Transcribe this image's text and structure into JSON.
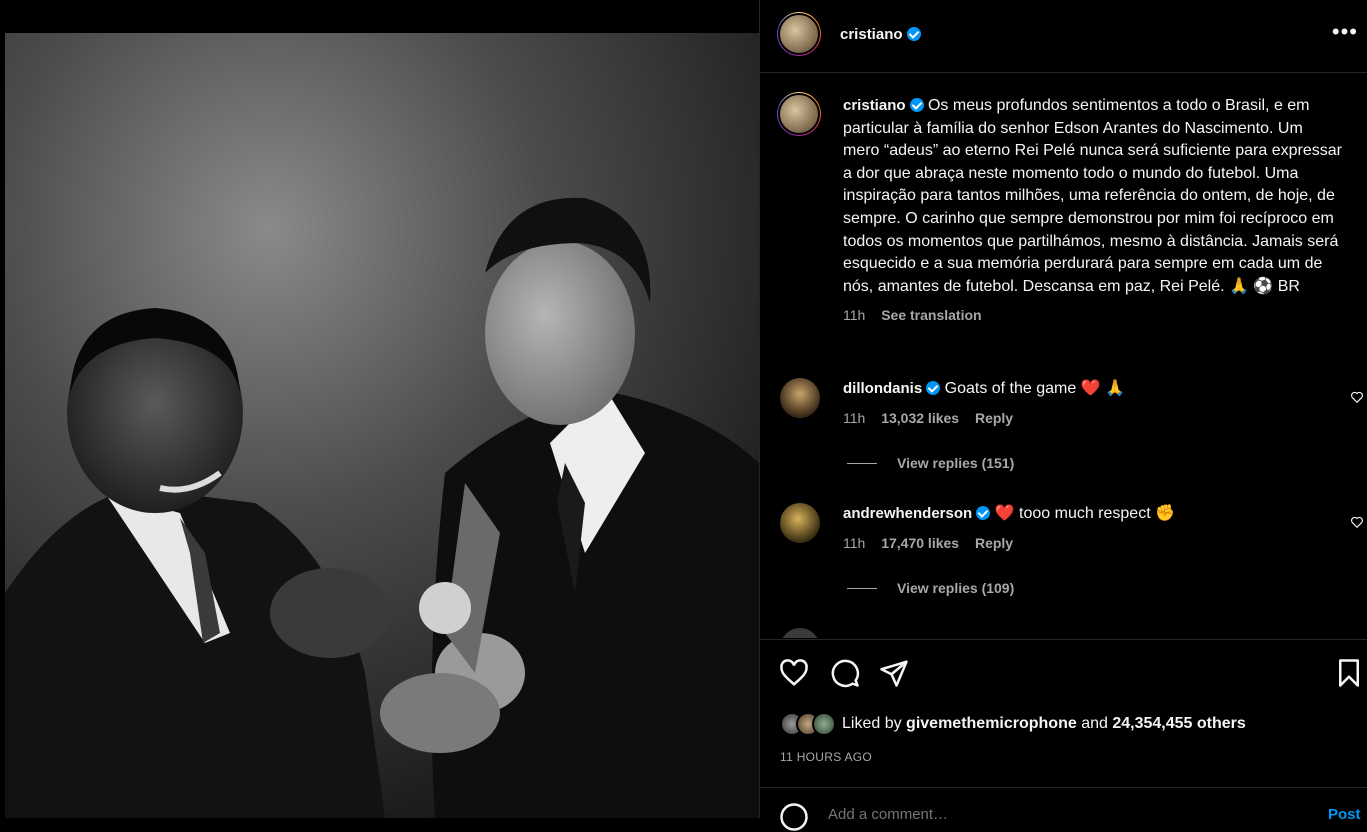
{
  "post": {
    "username": "cristiano",
    "more_label": "•••"
  },
  "caption": {
    "username": "cristiano",
    "text": "Os meus profundos sentimentos a todo o Brasil, e em particular à família do senhor Edson Arantes do Nascimento. Um mero “adeus” ao eterno Rei Pelé nunca será suficiente para expressar a dor que abraça neste momento todo o mundo do futebol. Uma inspiração para tantos milhões, uma referência do ontem, de hoje, de sempre. O carinho que sempre demonstrou por mim foi recíproco em todos os momentos que partilhámos, mesmo à distância. Jamais será esquecido e a sua memória perdurará para sempre em cada um de nós, amantes de futebol. Descansa em paz, Rei Pelé. 🙏 ⚽ BR",
    "time": "11h",
    "see_translation": "See translation"
  },
  "comments": [
    {
      "username": "dillondanis",
      "text": "Goats of the game ❤️ 🙏",
      "time": "11h",
      "likes": "13,032 likes",
      "reply": "Reply",
      "view_replies": "View replies (151)"
    },
    {
      "username": "andrewhenderson",
      "text": "❤️ tooo much respect ✊",
      "time": "11h",
      "likes": "17,470 likes",
      "reply": "Reply",
      "view_replies": "View replies (109)"
    }
  ],
  "engagement": {
    "liked_by_prefix": "Liked by",
    "liked_by_user": "givemethemicrophone",
    "and": "and",
    "others": "24,354,455 others",
    "timestamp": "11 HOURS AGO"
  },
  "add_comment": {
    "placeholder": "Add a comment…",
    "post_label": "Post"
  },
  "icons": [
    "heart-icon",
    "comment-icon",
    "share-icon",
    "bookmark-icon",
    "verified-icon",
    "more-icon",
    "emoji-icon"
  ],
  "colors": {
    "verified": "#0095f6",
    "background": "#000000",
    "muted": "#a8a8a8",
    "border": "#262626"
  }
}
